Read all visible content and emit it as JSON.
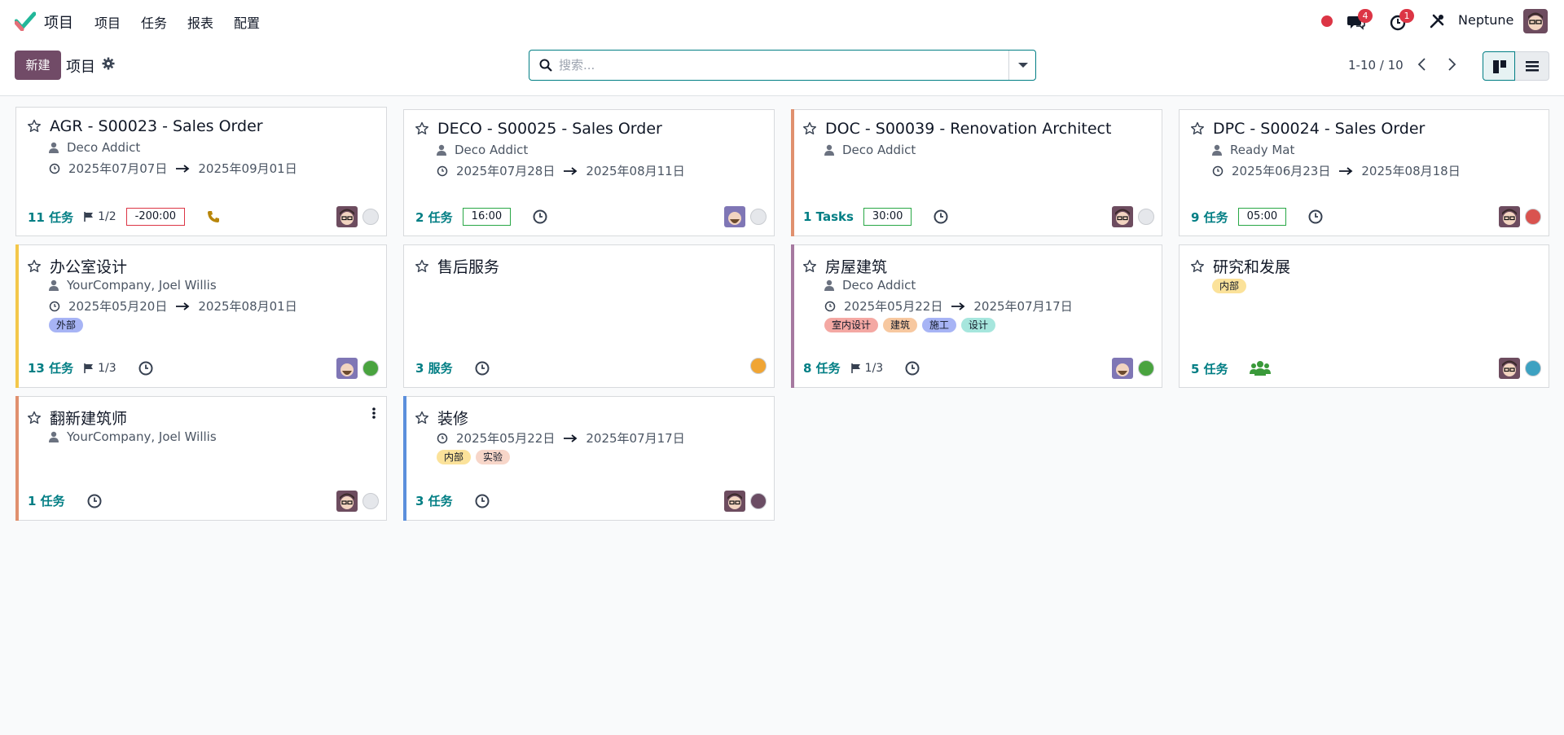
{
  "app": {
    "name": "项目",
    "menu": [
      "项目",
      "任务",
      "报表",
      "配置"
    ],
    "user_name": "Neptune",
    "chat_count": "4",
    "activity_count": "1"
  },
  "control": {
    "new_label": "新建",
    "breadcrumb": "项目",
    "search_placeholder": "搜索...",
    "pager": "1-10 / 10"
  },
  "colors": {
    "brand": "#714b67",
    "link": "#017e84",
    "danger": "#dc3545"
  },
  "cards": [
    {
      "title": "AGR - S00023 - Sales Order",
      "customer": "Deco Addict",
      "date_start": "2025年07月07日",
      "date_end": "2025年09月01日",
      "tasks": "11 任务",
      "milestone": "1/2",
      "time": "-200:00",
      "time_state": "danger",
      "activity_icon": "phone-icon",
      "status": "grey",
      "accent": "none"
    },
    {
      "title": "DECO - S00025 - Sales Order",
      "customer": "Deco Addict",
      "date_start": "2025年07月28日",
      "date_end": "2025年08月11日",
      "tasks": "2 任务",
      "time": "16:00",
      "time_state": "success",
      "activity_icon": "clock-icon",
      "status": "grey",
      "accent": "none"
    },
    {
      "title": "DOC - S00039 - Renovation Architect",
      "customer": "Deco Addict",
      "tasks": "1 Tasks",
      "time": "30:00",
      "time_state": "success",
      "activity_icon": "clock-icon",
      "status": "grey",
      "accent": "#e0906e"
    },
    {
      "title": "DPC - S00024 - Sales Order",
      "customer": "Ready Mat",
      "date_start": "2025年06月23日",
      "date_end": "2025年08月18日",
      "tasks": "9 任务",
      "time": "05:00",
      "time_state": "success",
      "activity_icon": "clock-icon",
      "status": "red",
      "accent": "none"
    },
    {
      "title": "办公室设计",
      "customer": "YourCompany, Joel Willis",
      "date_start": "2025年05月20日",
      "date_end": "2025年08月01日",
      "tags": [
        {
          "label": "外部",
          "color": "#a7b4f5"
        }
      ],
      "tasks": "13 任务",
      "milestone": "1/3",
      "activity_icon": "clock-icon",
      "status": "green",
      "accent": "#f3c74a"
    },
    {
      "title": "售后服务",
      "tasks": "3 服务",
      "activity_icon": "clock-icon",
      "status": "orange",
      "accent": "none"
    },
    {
      "title": "房屋建筑",
      "customer": "Deco Addict",
      "date_start": "2025年05月22日",
      "date_end": "2025年07月17日",
      "tags": [
        {
          "label": "室内设计",
          "color": "#f4a8a3"
        },
        {
          "label": "建筑",
          "color": "#f7c8a0"
        },
        {
          "label": "施工",
          "color": "#a7b4f5"
        },
        {
          "label": "设计",
          "color": "#a6e6dd"
        }
      ],
      "tasks": "8 任务",
      "milestone": "1/3",
      "activity_icon": "clock-icon",
      "status": "green",
      "accent": "#a679a0"
    },
    {
      "title": "研究和发展",
      "tags": [
        {
          "label": "内部",
          "color": "#fbe29a"
        }
      ],
      "tasks": "5 任务",
      "activity_icon": "users-icon",
      "status": "teal",
      "accent": "none"
    },
    {
      "title": "翻新建筑师",
      "customer": "YourCompany, Joel Willis",
      "tasks": "1 任务",
      "activity_icon": "clock-icon",
      "status": "grey",
      "accent": "#e0906e"
    },
    {
      "title": "装修",
      "date_start": "2025年05月22日",
      "date_end": "2025年07月17日",
      "tags": [
        {
          "label": "内部",
          "color": "#fbe29a"
        },
        {
          "label": "实验",
          "color": "#f7d6c9"
        }
      ],
      "tasks": "3 任务",
      "activity_icon": "clock-icon",
      "status": "purple",
      "accent": "#5b8fdc"
    }
  ]
}
